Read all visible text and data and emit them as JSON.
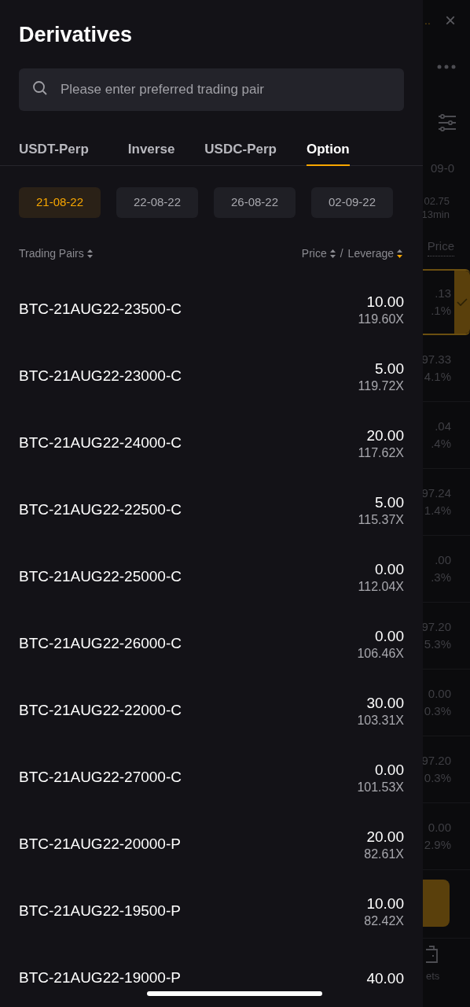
{
  "drawer": {
    "title": "Derivatives",
    "search": {
      "placeholder": "Please enter preferred trading pair"
    },
    "tabs": [
      {
        "label": "USDT-Perp",
        "selected": false
      },
      {
        "label": "Inverse",
        "selected": false
      },
      {
        "label": "USDC-Perp",
        "selected": false
      },
      {
        "label": "Option",
        "selected": true
      }
    ],
    "dates": [
      {
        "label": "21-08-22",
        "selected": true
      },
      {
        "label": "22-08-22",
        "selected": false
      },
      {
        "label": "26-08-22",
        "selected": false
      },
      {
        "label": "02-09-22",
        "selected": false
      }
    ],
    "columns": {
      "pairs": "Trading Pairs",
      "price": "Price",
      "separator": "/",
      "leverage": "Leverage"
    },
    "rows": [
      {
        "pair": "BTC-21AUG22-23500-C",
        "price": "10.00",
        "leverage": "119.60X"
      },
      {
        "pair": "BTC-21AUG22-23000-C",
        "price": "5.00",
        "leverage": "119.72X"
      },
      {
        "pair": "BTC-21AUG22-24000-C",
        "price": "20.00",
        "leverage": "117.62X"
      },
      {
        "pair": "BTC-21AUG22-22500-C",
        "price": "5.00",
        "leverage": "115.37X"
      },
      {
        "pair": "BTC-21AUG22-25000-C",
        "price": "0.00",
        "leverage": "112.04X"
      },
      {
        "pair": "BTC-21AUG22-26000-C",
        "price": "0.00",
        "leverage": "106.46X"
      },
      {
        "pair": "BTC-21AUG22-22000-C",
        "price": "30.00",
        "leverage": "103.31X"
      },
      {
        "pair": "BTC-21AUG22-27000-C",
        "price": "0.00",
        "leverage": "101.53X"
      },
      {
        "pair": "BTC-21AUG22-20000-P",
        "price": "20.00",
        "leverage": "82.61X"
      },
      {
        "pair": "BTC-21AUG22-19500-P",
        "price": "10.00",
        "leverage": "82.42X"
      },
      {
        "pair": "BTC-21AUG22-19000-P",
        "price": "40.00"
      }
    ]
  },
  "backdrop": {
    "tab_hint": "..",
    "close": "×",
    "date_hint": "09-0",
    "timer": {
      "value": "02.75",
      "time": "13min"
    },
    "column": "Price",
    "rows": [
      {
        "value": ".13",
        "change": ".1%",
        "selected": true
      },
      {
        "value": "97.33",
        "change": "4.1%",
        "selected": false
      },
      {
        "value": ".04",
        "change": ".4%",
        "selected": false
      },
      {
        "value": "97.24",
        "change": "1.4%",
        "selected": false
      },
      {
        "value": ".00",
        "change": ".3%",
        "selected": false
      },
      {
        "value": "97.20",
        "change": "5.3%",
        "selected": false
      },
      {
        "value": "0.00",
        "change": "0.3%",
        "selected": false
      },
      {
        "value": "97.20",
        "change": "0.3%",
        "selected": false
      },
      {
        "value": "0.00",
        "change": "2.9%",
        "selected": false
      }
    ],
    "nav_label": "ets"
  }
}
